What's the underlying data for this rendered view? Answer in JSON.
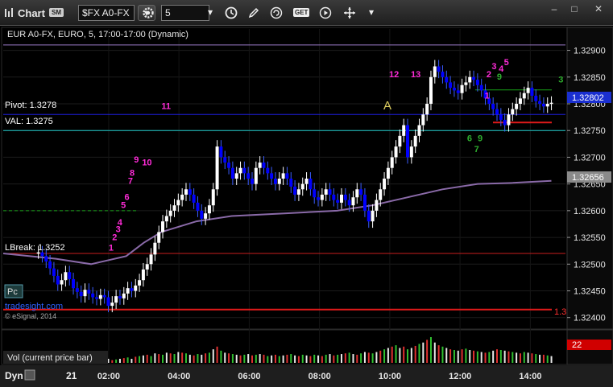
{
  "window": {
    "title": "Chart",
    "title_badge": "SM",
    "symbol": "$FX A0-FX",
    "interval": "5",
    "minimize": "–",
    "restore": "□",
    "close": "✕",
    "toolbar_icons": [
      "gear-icon",
      "clock-icon",
      "pencil-icon",
      "refresh-icon",
      "get-icon",
      "play-icon",
      "move-icon"
    ],
    "get_label": "GET"
  },
  "chart_title": "EUR A0-FX, EURO, 5, 17:00-17:00 (Dynamic)",
  "colors": {
    "background": "#000000",
    "panel_border": "#2a2a2a",
    "candle_up": "#ffffff",
    "candle_down": "#0000ff",
    "pivot": "#1e1edc",
    "val": "#20c8c8",
    "lbreak": "#c81e1e",
    "ma": "#8a6aa8",
    "volume": "#e0e0e0"
  },
  "levels": {
    "top_line": "1.32910",
    "pivot_label": "Pivot: 1.3278",
    "val_label": "VAL: 1.3275",
    "lbreak_label": "LBreak: 1.3252",
    "red_level_value": "1.3",
    "dashed_green": "1.32600",
    "last_price": "1.32802",
    "ma_price": "1.32656",
    "letter_a": "A"
  },
  "watermark": {
    "pc_badge": "Pc",
    "site": "tradesight.com",
    "copyright": "© eSignal, 2014"
  },
  "volume_panel": {
    "label": "Vol (current price bar)",
    "value": "22"
  },
  "bottom": {
    "dyn_label": "Dyn",
    "day_label": "21"
  },
  "chart_data": {
    "type": "candlestick",
    "title": "EUR A0-FX, EURO, 5, 17:00-17:00 (Dynamic)",
    "y_ticks": [
      "1.32900",
      "1.32850",
      "1.32800",
      "1.32750",
      "1.32700",
      "1.32650",
      "1.32600",
      "1.32550",
      "1.32500",
      "1.32450",
      "1.32400"
    ],
    "x_ticks": [
      "02:00",
      "04:00",
      "06:00",
      "08:00",
      "10:00",
      "12:00",
      "14:00"
    ],
    "ylim": [
      1.3238,
      1.3294
    ],
    "x_range_hours": [
      -1.0,
      15.0
    ],
    "closes": [
      1.32522,
      1.32515,
      1.32505,
      1.32492,
      1.32478,
      1.32462,
      1.3247,
      1.32485,
      1.32472,
      1.32455,
      1.32448,
      1.3244,
      1.32452,
      1.32445,
      1.32438,
      1.32435,
      1.32442,
      1.32438,
      1.32422,
      1.32428,
      1.3244,
      1.32436,
      1.32445,
      1.32455,
      1.3245,
      1.3246,
      1.3247,
      1.3249,
      1.325,
      1.32518,
      1.3254,
      1.3256,
      1.3258,
      1.3259,
      1.326,
      1.3261,
      1.3262,
      1.3263,
      1.3264,
      1.3263,
      1.32615,
      1.326,
      1.32585,
      1.32595,
      1.3261,
      1.3264,
      1.3272,
      1.327,
      1.3269,
      1.3268,
      1.3266,
      1.3267,
      1.3268,
      1.3267,
      1.3266,
      1.3265,
      1.3268,
      1.3269,
      1.3268,
      1.3267,
      1.3266,
      1.3265,
      1.3266,
      1.3267,
      1.3266,
      1.32645,
      1.3263,
      1.3264,
      1.3265,
      1.3266,
      1.3264,
      1.32625,
      1.3262,
      1.3263,
      1.3264,
      1.3263,
      1.3262,
      1.32615,
      1.3263,
      1.3262,
      1.3261,
      1.32625,
      1.3264,
      1.3263,
      1.326,
      1.3258,
      1.326,
      1.3262,
      1.3264,
      1.3266,
      1.3268,
      1.327,
      1.3272,
      1.3274,
      1.3276,
      1.327,
      1.3272,
      1.3274,
      1.3276,
      1.3278,
      1.328,
      1.3285,
      1.3287,
      1.3286,
      1.3285,
      1.3284,
      1.3283,
      1.32825,
      1.3282,
      1.32835,
      1.3284,
      1.3285,
      1.32845,
      1.32835,
      1.32825,
      1.3281,
      1.328,
      1.3279,
      1.3278,
      1.3277,
      1.3276,
      1.3278,
      1.3279,
      1.328,
      1.3281,
      1.3282,
      1.3283,
      1.32815,
      1.32805,
      1.328,
      1.32795,
      1.328,
      1.32802
    ],
    "volume": [
      6,
      4,
      5,
      3,
      4,
      3,
      5,
      4,
      6,
      5,
      4,
      3,
      5,
      6,
      4,
      3,
      4,
      5,
      6,
      4,
      5,
      6,
      7,
      8,
      6,
      9,
      10,
      11,
      12,
      10,
      14,
      13,
      12,
      15,
      14,
      13,
      16,
      15,
      14,
      12,
      11,
      13,
      12,
      14,
      15,
      20,
      24,
      18,
      15,
      14,
      13,
      12,
      11,
      12,
      13,
      11,
      12,
      13,
      12,
      10,
      11,
      12,
      10,
      11,
      12,
      13,
      11,
      10,
      12,
      11,
      10,
      12,
      11,
      10,
      12,
      13,
      11,
      12,
      13,
      14,
      15,
      13,
      12,
      14,
      16,
      15,
      14,
      16,
      18,
      20,
      22,
      24,
      26,
      22,
      24,
      20,
      22,
      25,
      28,
      30,
      34,
      38,
      30,
      26,
      24,
      22,
      20,
      19,
      18,
      20,
      21,
      19,
      18,
      17,
      16,
      15,
      16,
      18,
      20,
      19,
      18,
      17,
      16,
      15,
      14,
      16,
      15,
      14,
      13,
      12,
      12,
      11,
      10
    ],
    "moving_average": [
      [
        -1.0,
        1.3252
      ],
      [
        0.5,
        1.3251
      ],
      [
        1.5,
        1.325
      ],
      [
        2.5,
        1.32515
      ],
      [
        3.0,
        1.3254
      ],
      [
        3.5,
        1.3256
      ],
      [
        4.5,
        1.3258
      ],
      [
        5.5,
        1.3259
      ],
      [
        7.0,
        1.32595
      ],
      [
        8.5,
        1.326
      ],
      [
        9.5,
        1.3261
      ],
      [
        10.5,
        1.32625
      ],
      [
        11.5,
        1.3264
      ],
      [
        12.5,
        1.3265
      ],
      [
        13.5,
        1.32652
      ],
      [
        14.6,
        1.32656
      ]
    ],
    "levels": [
      {
        "label": "Pivot",
        "value": 1.3278
      },
      {
        "label": "VAL",
        "value": 1.3275
      },
      {
        "label": "LBreak",
        "value": 1.3252
      },
      {
        "label": "",
        "value": 1.32415
      }
    ],
    "count_labels": [
      {
        "text": "1",
        "x": 2.0,
        "y": 1.32525,
        "color": "#ff2bd8"
      },
      {
        "text": "2",
        "x": 2.1,
        "y": 1.32545,
        "color": "#ff2bd8"
      },
      {
        "text": "3",
        "x": 2.2,
        "y": 1.3256,
        "color": "#ff2bd8"
      },
      {
        "text": "4",
        "x": 2.25,
        "y": 1.32573,
        "color": "#ff2bd8"
      },
      {
        "text": "5",
        "x": 2.35,
        "y": 1.32605,
        "color": "#ff2bd8"
      },
      {
        "text": "6",
        "x": 2.45,
        "y": 1.3262,
        "color": "#ff2bd8"
      },
      {
        "text": "7",
        "x": 2.55,
        "y": 1.3265,
        "color": "#ff2bd8"
      },
      {
        "text": "8",
        "x": 2.6,
        "y": 1.32665,
        "color": "#ff2bd8"
      },
      {
        "text": "9",
        "x": 2.72,
        "y": 1.3269,
        "color": "#ff2bd8"
      },
      {
        "text": "10",
        "x": 2.95,
        "y": 1.32685,
        "color": "#ff2bd8"
      },
      {
        "text": "11",
        "x": 3.5,
        "y": 1.3279,
        "color": "#ff2bd8"
      },
      {
        "text": "12",
        "x": 9.98,
        "y": 1.3285,
        "color": "#ff2bd8"
      },
      {
        "text": "13",
        "x": 10.6,
        "y": 1.3285,
        "color": "#ff2bd8"
      },
      {
        "text": "1",
        "x": 12.7,
        "y": 1.3281,
        "color": "#ff2bd8"
      },
      {
        "text": "2",
        "x": 12.75,
        "y": 1.3285,
        "color": "#ff2bd8"
      },
      {
        "text": "3",
        "x": 12.9,
        "y": 1.32865,
        "color": "#ff2bd8"
      },
      {
        "text": "4",
        "x": 13.1,
        "y": 1.3286,
        "color": "#ff2bd8"
      },
      {
        "text": "5",
        "x": 13.25,
        "y": 1.32872,
        "color": "#ff2bd8"
      },
      {
        "text": "9",
        "x": 13.05,
        "y": 1.32845,
        "color": "#2fae2f"
      },
      {
        "text": "3",
        "x": 14.8,
        "y": 1.3284,
        "color": "#2fae2f"
      },
      {
        "text": "6",
        "x": 12.2,
        "y": 1.3273,
        "color": "#2fae2f"
      },
      {
        "text": "9",
        "x": 12.5,
        "y": 1.3273,
        "color": "#2fae2f"
      },
      {
        "text": "7",
        "x": 12.4,
        "y": 1.3271,
        "color": "#2fae2f"
      }
    ]
  }
}
